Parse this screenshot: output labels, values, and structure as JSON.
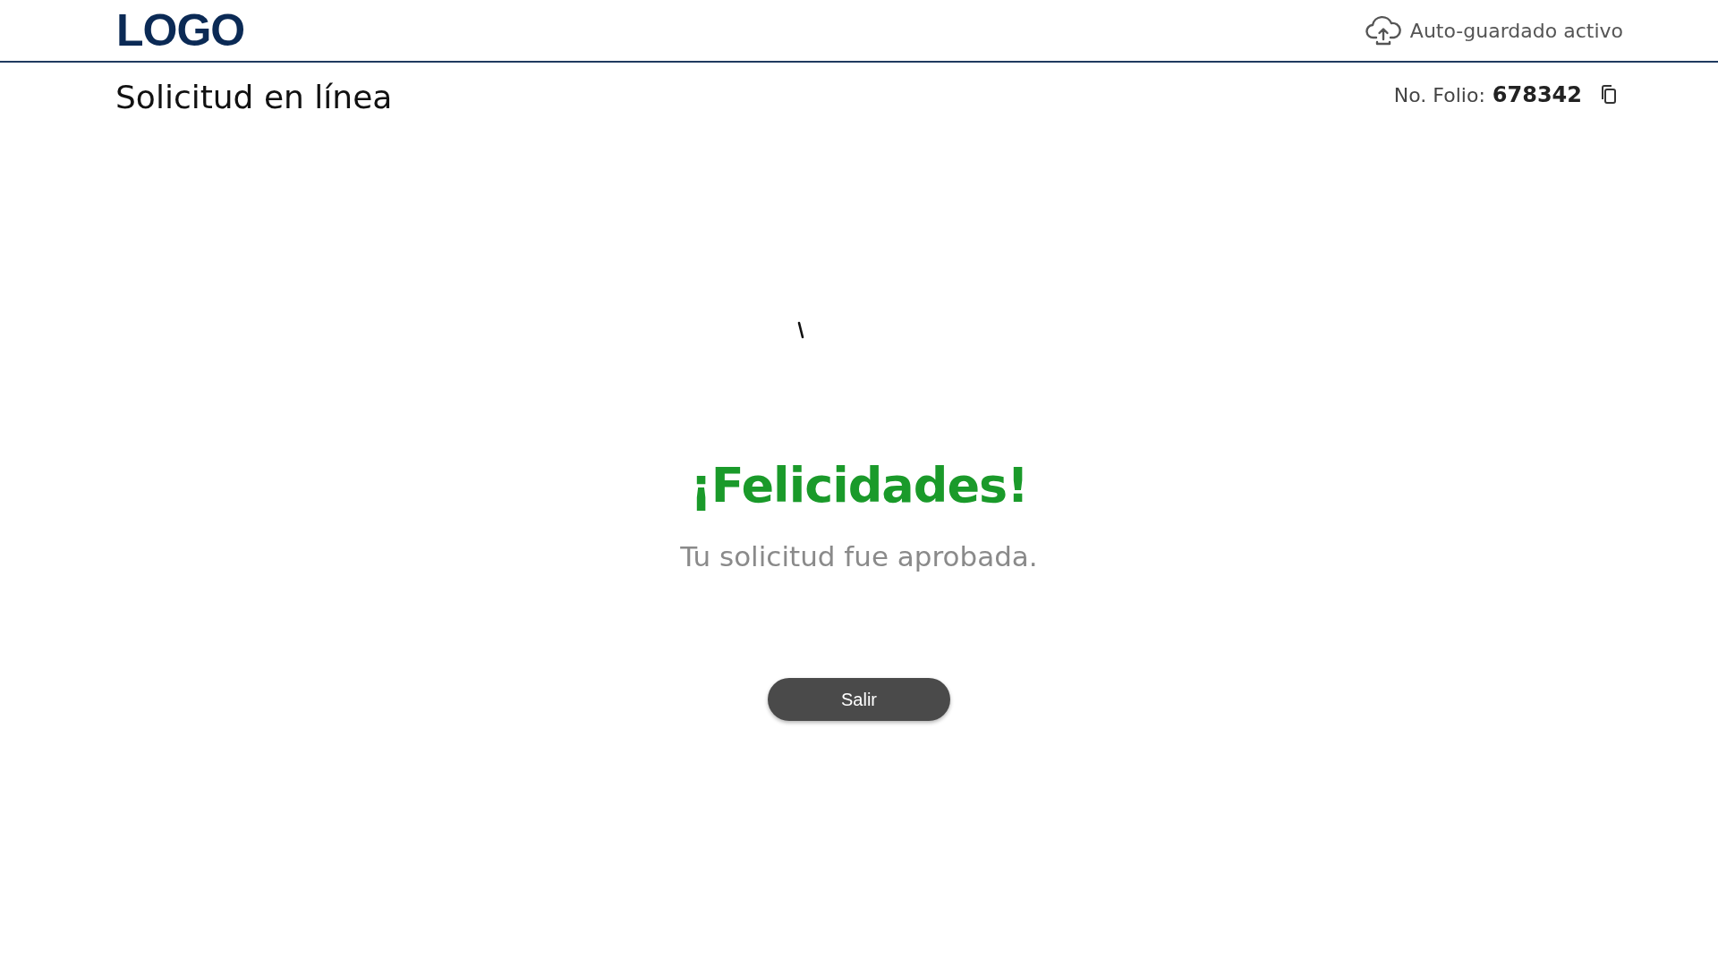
{
  "header": {
    "logo": "LOGO",
    "autosave": "Auto-guardado activo"
  },
  "page": {
    "title": "Solicitud en línea",
    "folio_label": "No. Folio:",
    "folio_number": "678342"
  },
  "result": {
    "heading": "¡Felicidades!",
    "message": "Tu solicitud fue aprobada.",
    "button": "Salir"
  }
}
